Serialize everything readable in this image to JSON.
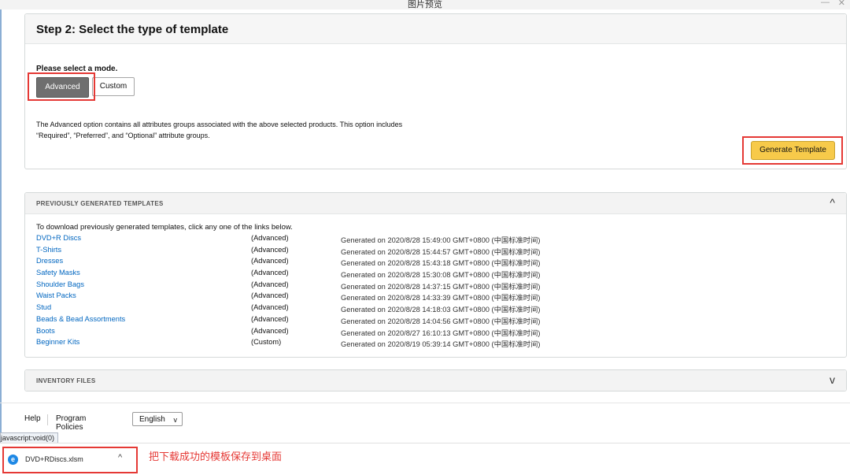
{
  "window": {
    "title": "图片预览",
    "min_glyph": "—",
    "close_glyph": "✕"
  },
  "step2": {
    "title": "Step 2: Select the type of template",
    "mode_label": "Please select a mode.",
    "modes": [
      {
        "label": "Advanced",
        "selected": true
      },
      {
        "label": "Custom",
        "selected": false
      }
    ],
    "description": "The Advanced option contains all attributes groups associated with the above selected products. This option includes “Required”, “Preferred”, and “Optional” attribute groups.",
    "generate_label": "Generate Template"
  },
  "previous": {
    "title": "PREVIOUSLY GENERATED TEMPLATES",
    "chevron": "^",
    "intro": "To download previously generated templates, click any one of the links below.",
    "rows": [
      {
        "name": "DVD+R Discs",
        "mode": "(Advanced)",
        "generated": "Generated on 2020/8/28 15:49:00 GMT+0800 (中国标准时间)"
      },
      {
        "name": "T-Shirts",
        "mode": "(Advanced)",
        "generated": "Generated on 2020/8/28 15:44:57 GMT+0800 (中国标准时间)"
      },
      {
        "name": "Dresses",
        "mode": "(Advanced)",
        "generated": "Generated on 2020/8/28 15:43:18 GMT+0800 (中国标准时间)"
      },
      {
        "name": "Safety Masks",
        "mode": "(Advanced)",
        "generated": "Generated on 2020/8/28 15:30:08 GMT+0800 (中国标准时间)"
      },
      {
        "name": "Shoulder Bags",
        "mode": "(Advanced)",
        "generated": "Generated on 2020/8/28 14:37:15 GMT+0800 (中国标准时间)"
      },
      {
        "name": "Waist Packs",
        "mode": "(Advanced)",
        "generated": "Generated on 2020/8/28 14:33:39 GMT+0800 (中国标准时间)"
      },
      {
        "name": "Stud",
        "mode": "(Advanced)",
        "generated": "Generated on 2020/8/28 14:18:03 GMT+0800 (中国标准时间)"
      },
      {
        "name": "Beads & Bead Assortments",
        "mode": "(Advanced)",
        "generated": "Generated on 2020/8/28 14:04:56 GMT+0800 (中国标准时间)"
      },
      {
        "name": "Boots",
        "mode": "(Advanced)",
        "generated": "Generated on 2020/8/27 16:10:13 GMT+0800 (中国标准时间)"
      },
      {
        "name": "Beginner Kits",
        "mode": "(Custom)",
        "generated": "Generated on 2020/8/19 05:39:14 GMT+0800 (中国标准时间)"
      }
    ]
  },
  "inventory": {
    "title": "INVENTORY FILES",
    "chevron": "v"
  },
  "footer": {
    "help": "Help",
    "policies": "Program Policies",
    "language": "English",
    "language_arrow": "v"
  },
  "statusbar": {
    "text": "javascript:void(0)"
  },
  "download": {
    "filename": "DVD+RDiscs.xlsm",
    "caret": "^",
    "icon": "ie-icon"
  },
  "annotation": "把下载成功的模板保存到桌面",
  "colors": {
    "link": "#0066c0",
    "primary_button": "#f7ca4a",
    "selected_mode": "#6f6f6f",
    "highlight": "#e53935"
  }
}
